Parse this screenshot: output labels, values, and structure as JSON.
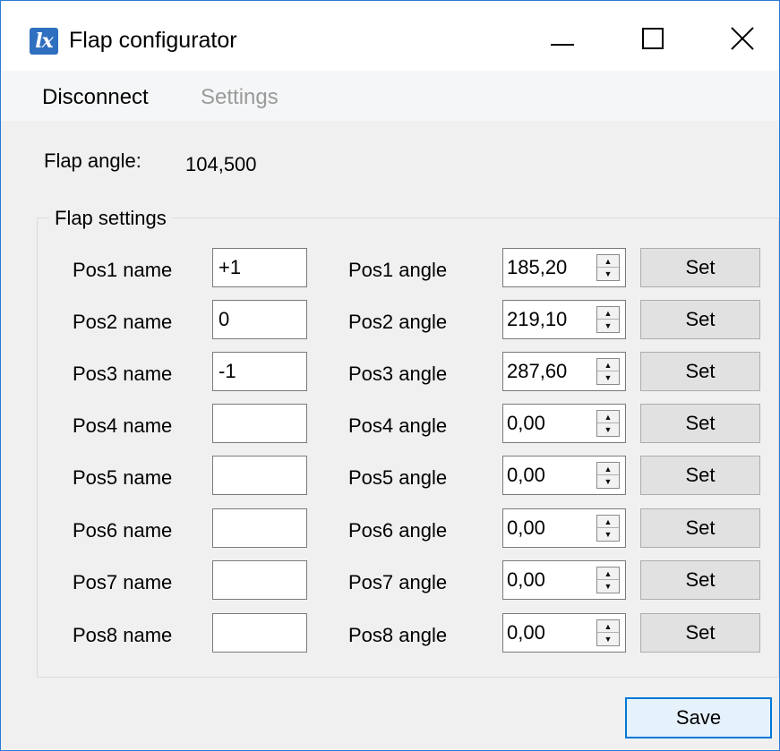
{
  "window": {
    "title": "Flap configurator",
    "icon_text": "lx",
    "controls": {
      "minimize": "minimize-icon",
      "maximize": "maximize-icon",
      "close": "close-icon"
    }
  },
  "menu": {
    "items": [
      {
        "label": "Disconnect",
        "enabled": true
      },
      {
        "label": "Settings",
        "enabled": false
      }
    ]
  },
  "flap_angle": {
    "label": "Flap angle:",
    "value": "104,500"
  },
  "flap_settings": {
    "title": "Flap settings",
    "set_label": "Set",
    "rows": [
      {
        "name_label": "Pos1 name",
        "name_value": "+1",
        "angle_label": "Pos1 angle",
        "angle_value": "185,20"
      },
      {
        "name_label": "Pos2 name",
        "name_value": "0",
        "angle_label": "Pos2 angle",
        "angle_value": "219,10"
      },
      {
        "name_label": "Pos3 name",
        "name_value": "-1",
        "angle_label": "Pos3 angle",
        "angle_value": "287,60"
      },
      {
        "name_label": "Pos4 name",
        "name_value": "",
        "angle_label": "Pos4 angle",
        "angle_value": "0,00"
      },
      {
        "name_label": "Pos5 name",
        "name_value": "",
        "angle_label": "Pos5 angle",
        "angle_value": "0,00"
      },
      {
        "name_label": "Pos6 name",
        "name_value": "",
        "angle_label": "Pos6 angle",
        "angle_value": "0,00"
      },
      {
        "name_label": "Pos7 name",
        "name_value": "",
        "angle_label": "Pos7 angle",
        "angle_value": "0,00"
      },
      {
        "name_label": "Pos8 name",
        "name_value": "",
        "angle_label": "Pos8 angle",
        "angle_value": "0,00"
      }
    ]
  },
  "save_label": "Save",
  "colors": {
    "accent": "#0078d7",
    "window_border": "#2b7bd6",
    "disabled_text": "#9a9a9a"
  }
}
